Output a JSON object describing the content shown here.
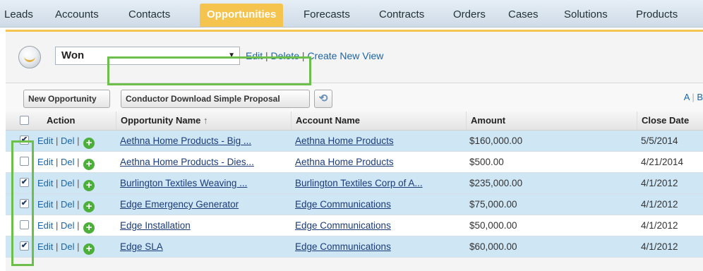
{
  "tabs": [
    {
      "label": "Leads",
      "active": false
    },
    {
      "label": "Accounts",
      "active": false
    },
    {
      "label": "Contacts",
      "active": false
    },
    {
      "label": "Opportunities",
      "active": true
    },
    {
      "label": "Forecasts",
      "active": false
    },
    {
      "label": "Contracts",
      "active": false
    },
    {
      "label": "Orders",
      "active": false
    },
    {
      "label": "Cases",
      "active": false
    },
    {
      "label": "Solutions",
      "active": false
    },
    {
      "label": "Products",
      "active": false
    }
  ],
  "view": {
    "selected": "Won",
    "edit": "Edit",
    "delete": "Delete",
    "create": "Create New View"
  },
  "buttons": {
    "new_opportunity": "New Opportunity",
    "conductor": "Conductor Download Simple Proposal",
    "refresh_icon": "refresh-icon"
  },
  "alpha": [
    "A",
    "B"
  ],
  "table": {
    "headers": {
      "action": "Action",
      "name": "Opportunity Name",
      "sort": "↑",
      "account": "Account Name",
      "amount": "Amount",
      "close": "Close Date"
    },
    "action_links": {
      "edit": "Edit",
      "del": "Del"
    },
    "rows": [
      {
        "checked": true,
        "name": "Aethna Home Products - Big ...",
        "account": "Aethna Home Products",
        "amount": "$160,000.00",
        "close": "5/5/2014"
      },
      {
        "checked": false,
        "name": "Aethna Home Products - Dies...",
        "account": "Aethna Home Products",
        "amount": "$500.00",
        "close": "4/21/2014"
      },
      {
        "checked": true,
        "name": "Burlington Textiles Weaving ...",
        "account": "Burlington Textiles Corp of A...",
        "amount": "$235,000.00",
        "close": "4/1/2012"
      },
      {
        "checked": true,
        "name": "Edge Emergency Generator",
        "account": "Edge Communications",
        "amount": "$75,000.00",
        "close": "4/1/2012"
      },
      {
        "checked": false,
        "name": "Edge Installation",
        "account": "Edge Communications",
        "amount": "$50,000.00",
        "close": "4/1/2012"
      },
      {
        "checked": true,
        "name": "Edge SLA",
        "account": "Edge Communications",
        "amount": "$60,000.00",
        "close": "4/1/2012"
      }
    ]
  },
  "colors": {
    "active_tab": "#f4c44e",
    "highlight": "#6bbf4a",
    "selected_row": "#cfe6f5",
    "link": "#1a66a8"
  }
}
